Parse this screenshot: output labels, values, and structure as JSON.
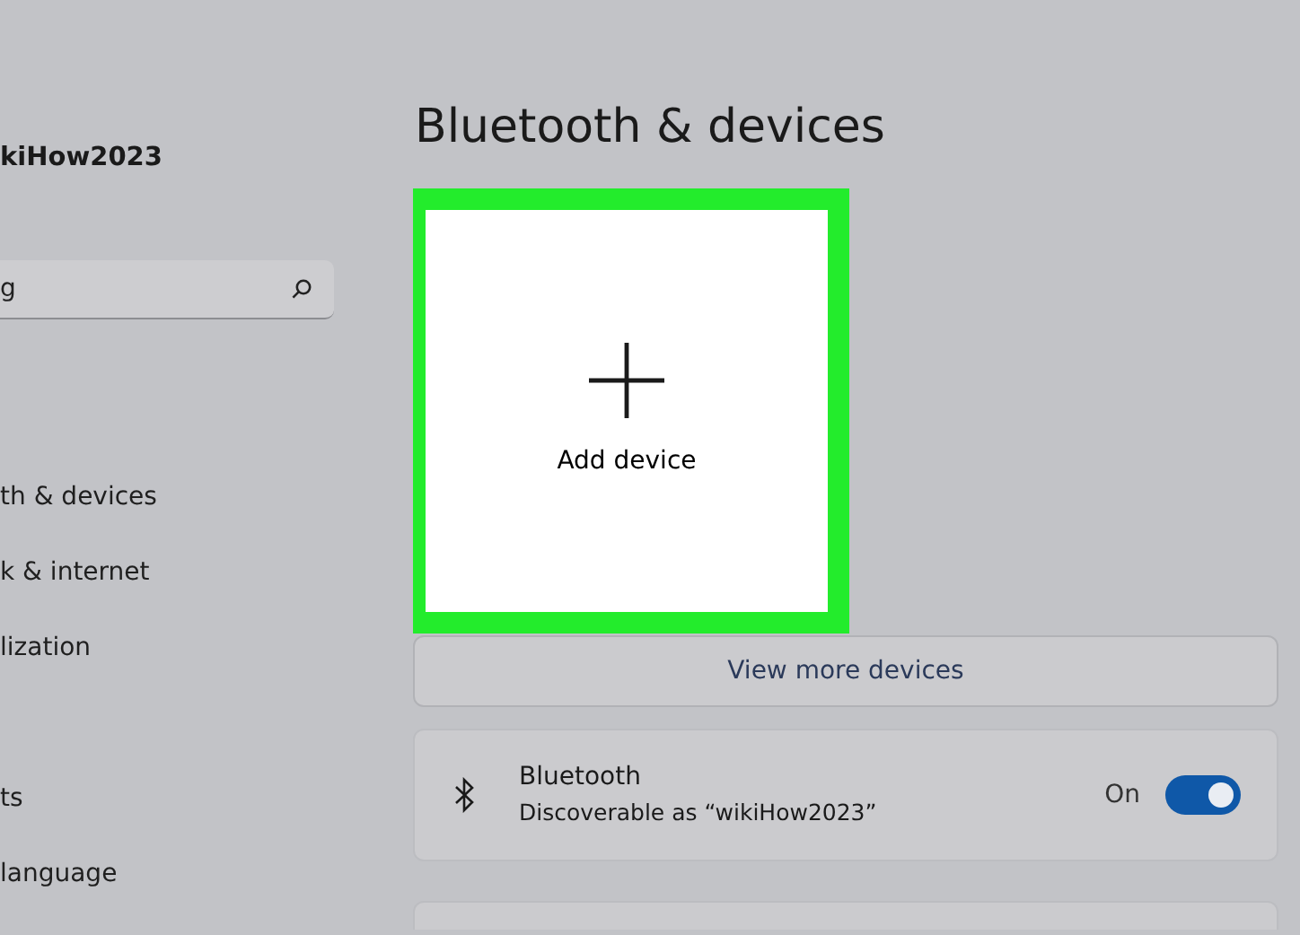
{
  "sidebar": {
    "user_name": "kiHow2023",
    "search": {
      "value": "g"
    },
    "items": [
      {
        "label": "th & devices"
      },
      {
        "label": "k & internet"
      },
      {
        "label": "lization"
      },
      {
        "label": "ts"
      },
      {
        "label": "language"
      }
    ]
  },
  "page_title": "Bluetooth & devices",
  "add_tile": {
    "label": "Add device",
    "highlighted": true
  },
  "view_more": "View more devices",
  "bluetooth": {
    "title": "Bluetooth",
    "subtitle": "Discoverable as “wikiHow2023”",
    "state_label": "On",
    "on": true
  }
}
